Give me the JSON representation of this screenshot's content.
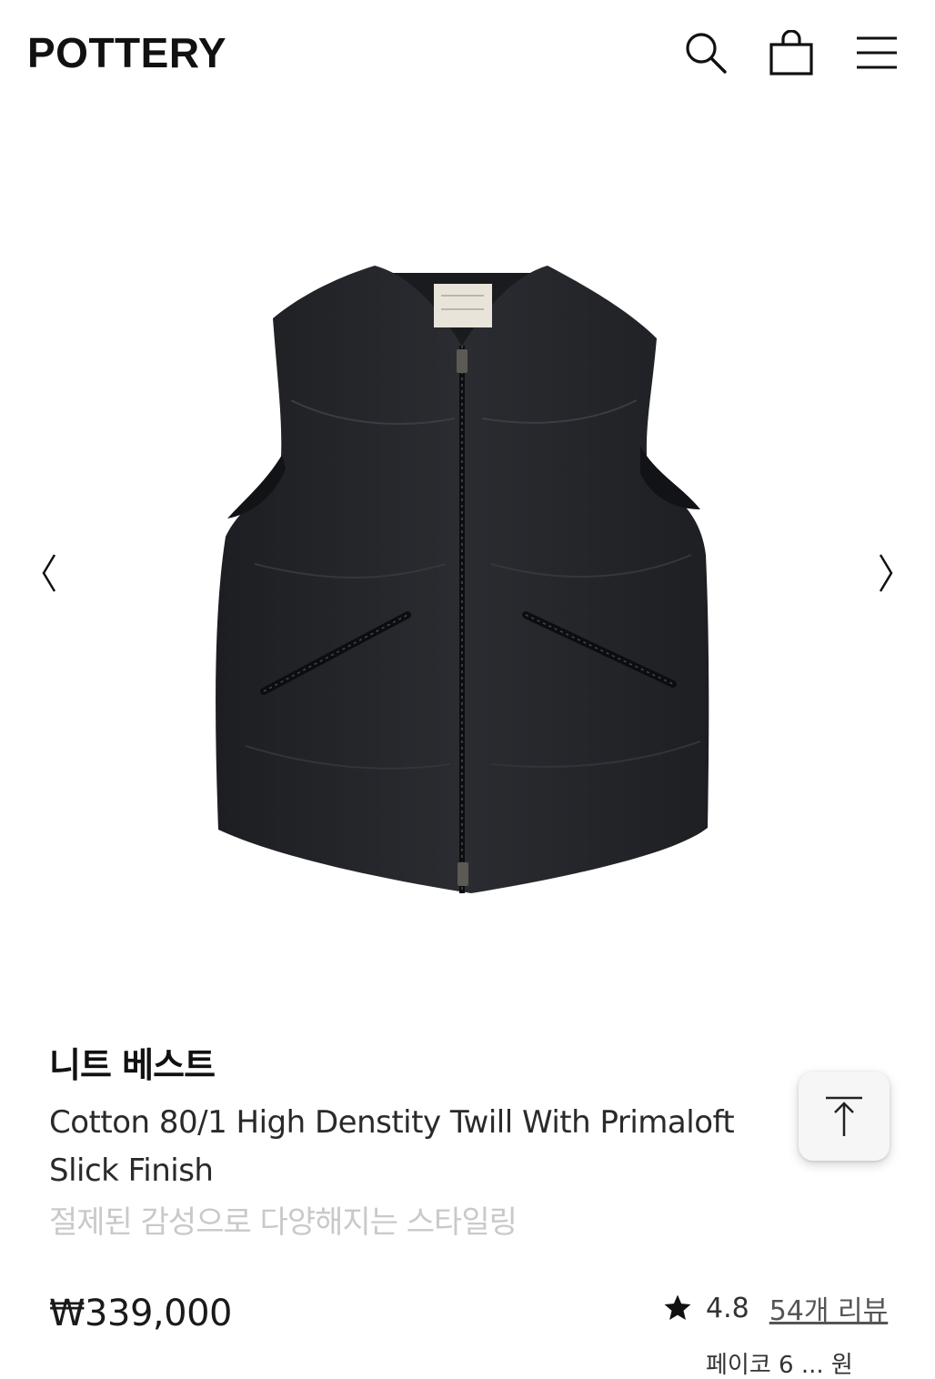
{
  "header": {
    "brand": "POTTERY",
    "icons": [
      "search-icon",
      "shopping-bag-icon",
      "hamburger-menu-icon"
    ]
  },
  "gallery": {
    "prev_icon": "chevron-left-icon",
    "next_icon": "chevron-right-icon",
    "image_subject": "black quilted zip-up vest"
  },
  "product": {
    "name_ko": "니트 베스트",
    "name_en": "Cotton 80/1 High Denstity Twill With Primaloft Slick Finish",
    "tagline": "절제된 감성으로 다양해지는 스타일링",
    "price": "₩339,000",
    "rating": "4.8",
    "reviews_label": "54개 리뷰",
    "partial_line": "페이코 6 ... 원"
  },
  "floating": {
    "scroll_top_icon": "arrow-up-to-top-icon"
  },
  "colors": {
    "text": "#111111",
    "muted": "#c9c9c9",
    "vest": "#25272b"
  }
}
